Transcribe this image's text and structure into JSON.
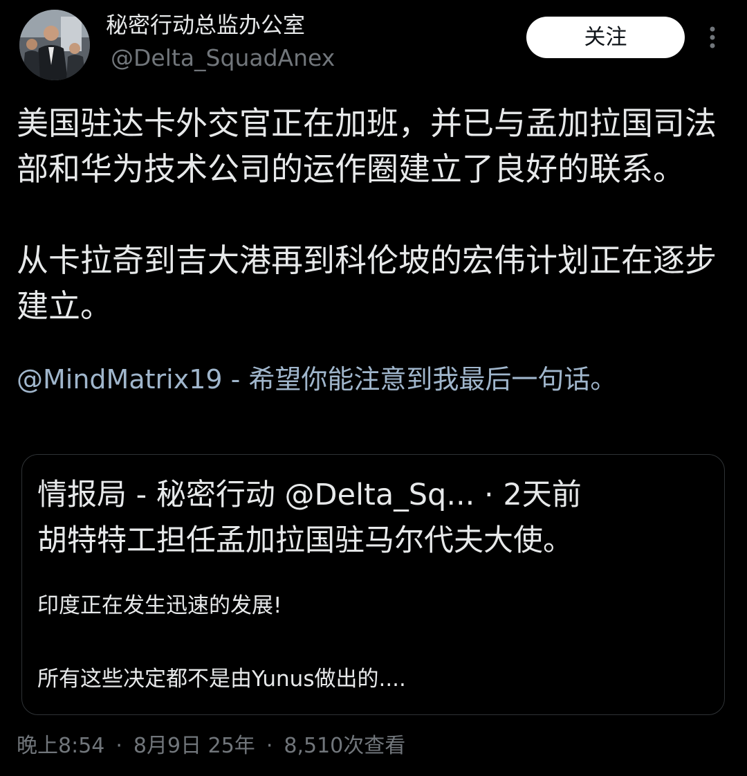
{
  "author": {
    "display_name": "秘密行动总监办公室",
    "handle": "@Delta_SquadAnex",
    "avatar_icon": "profile-photo"
  },
  "actions": {
    "follow_label": "关注",
    "more_icon": "more-vertical-icon"
  },
  "tweet": {
    "paragraph1": "美国驻达卡外交官正在加班，并已与孟加拉国司法部和华为技术公司的运作圈建立了良好的联系。",
    "paragraph2": "从卡拉奇到吉大港再到科伦坡的宏伟计划正在逐步建立。",
    "mention": "@MindMatrix19",
    "mention_rest": " - 希望你能注意到我最后一句话。"
  },
  "quoted_tweet": {
    "header": "情报局 - 秘密行动 @Delta_Sq... · 2天前",
    "line1": "胡特特工担任孟加拉国驻马尔代夫大使。",
    "line2": "印度正在发生迅速的发展!",
    "line3": "所有这些决定都不是由Yunus做出的...."
  },
  "meta": {
    "time": "晚上8:54",
    "date": "8月9日 25年",
    "views": "8,510次查看"
  },
  "colors": {
    "background": "#000000",
    "text_primary": "#e7e9ea",
    "text_secondary": "#71767b",
    "mention": "#a0b6cc",
    "card_border": "#2f3336",
    "follow_bg": "#ffffff"
  }
}
